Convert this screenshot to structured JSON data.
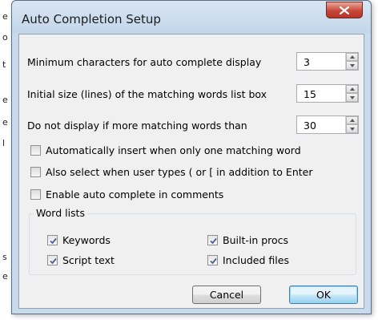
{
  "background": {
    "edge_chars": [
      "e",
      "o",
      "t",
      "e",
      "e",
      "l",
      "s",
      "e"
    ]
  },
  "window": {
    "title": "Auto Completion Setup",
    "close_symbol": "X"
  },
  "settings": [
    {
      "label": "Minimum characters for auto complete display",
      "value": "3"
    },
    {
      "label": "Initial size (lines) of the matching words list box",
      "value": "15"
    },
    {
      "label": "Do not display if more matching words than",
      "value": "30"
    }
  ],
  "options": [
    {
      "label": "Automatically insert when only one matching word",
      "checked": false
    },
    {
      "label": "Also select when user types ( or [ in addition to Enter",
      "checked": false
    },
    {
      "label": "Enable auto complete in comments",
      "checked": false
    }
  ],
  "word_lists": {
    "title": "Word lists",
    "items": [
      {
        "label": "Keywords",
        "checked": true
      },
      {
        "label": "Built-in procs",
        "checked": true
      },
      {
        "label": "Script text",
        "checked": true
      },
      {
        "label": "Included files",
        "checked": true
      }
    ]
  },
  "buttons": {
    "cancel": "Cancel",
    "ok": "OK"
  },
  "colors": {
    "window_frame": "#c9daec",
    "client_bg": "#f0f0f0",
    "close_button": "#c7473a",
    "default_button": "#98d1ef"
  }
}
